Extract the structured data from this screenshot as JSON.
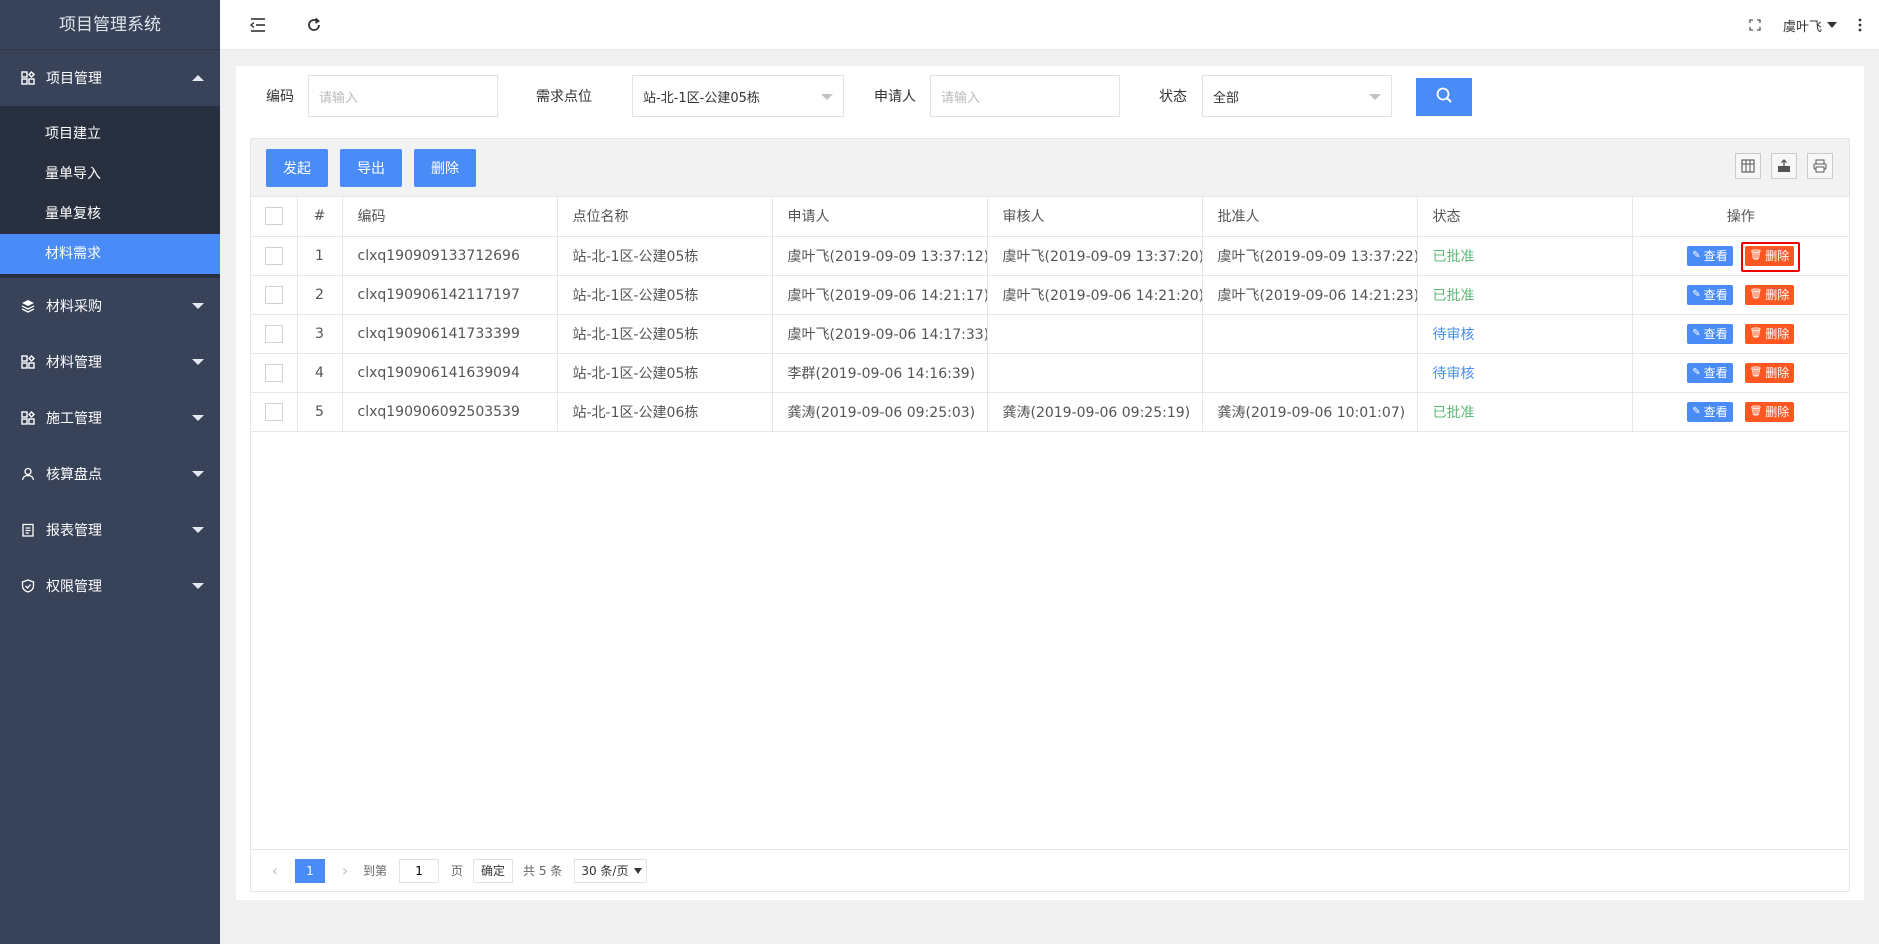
{
  "app": {
    "title": "项目管理系统"
  },
  "header": {
    "user_name": "虞叶飞"
  },
  "sidebar": {
    "groups": [
      {
        "label": "项目管理",
        "icon": "modules-icon",
        "expanded": true,
        "items": [
          {
            "label": "项目建立"
          },
          {
            "label": "量单导入"
          },
          {
            "label": "量单复核"
          },
          {
            "label": "材料需求",
            "active": true
          }
        ]
      },
      {
        "label": "材料采购",
        "icon": "layers-icon"
      },
      {
        "label": "材料管理",
        "icon": "modules-icon"
      },
      {
        "label": "施工管理",
        "icon": "modules-icon"
      },
      {
        "label": "核算盘点",
        "icon": "user-icon"
      },
      {
        "label": "报表管理",
        "icon": "report-icon"
      },
      {
        "label": "权限管理",
        "icon": "shield-icon"
      }
    ]
  },
  "filters": {
    "code_label": "编码",
    "code_placeholder": "请输入",
    "site_label": "需求点位",
    "site_value": "站-北-1区-公建05栋",
    "applicant_label": "申请人",
    "applicant_placeholder": "请输入",
    "status_label": "状态",
    "status_value": "全部"
  },
  "toolbar": {
    "create_label": "发起",
    "export_label": "导出",
    "delete_label": "删除"
  },
  "table": {
    "columns": [
      "#",
      "编码",
      "点位名称",
      "申请人",
      "审核人",
      "批准人",
      "状态",
      "操作"
    ],
    "rows": [
      {
        "no": "1",
        "code": "clxq190909133712696",
        "site": "站-北-1区-公建05栋",
        "applicant": "虞叶飞(2019-09-09 13:37:12)",
        "reviewer": "虞叶飞(2019-09-09 13:37:20)",
        "approver": "虞叶飞(2019-09-09 13:37:22)",
        "status": "已批准",
        "status_type": "approved"
      },
      {
        "no": "2",
        "code": "clxq190906142117197",
        "site": "站-北-1区-公建05栋",
        "applicant": "虞叶飞(2019-09-06 14:21:17)",
        "reviewer": "虞叶飞(2019-09-06 14:21:20)",
        "approver": "虞叶飞(2019-09-06 14:21:23)",
        "status": "已批准",
        "status_type": "approved"
      },
      {
        "no": "3",
        "code": "clxq190906141733399",
        "site": "站-北-1区-公建05栋",
        "applicant": "虞叶飞(2019-09-06 14:17:33)",
        "reviewer": "",
        "approver": "",
        "status": "待审核",
        "status_type": "pending"
      },
      {
        "no": "4",
        "code": "clxq190906141639094",
        "site": "站-北-1区-公建05栋",
        "applicant": "李群(2019-09-06 14:16:39)",
        "reviewer": "",
        "approver": "",
        "status": "待审核",
        "status_type": "pending"
      },
      {
        "no": "5",
        "code": "clxq190906092503539",
        "site": "站-北-1区-公建06栋",
        "applicant": "龚涛(2019-09-06 09:25:03)",
        "reviewer": "龚涛(2019-09-06 09:25:19)",
        "approver": "龚涛(2019-09-06 10:01:07)",
        "status": "已批准",
        "status_type": "approved"
      }
    ],
    "view_label": "查看",
    "delete_label": "删除"
  },
  "pager": {
    "current_page": "1",
    "goto_label": "到第",
    "goto_value": "1",
    "page_unit": "页",
    "confirm_label": "确定",
    "total_text": "共 5 条",
    "page_size": "30 条/页"
  },
  "colors": {
    "sidebar_bg": "#384259",
    "submenu_bg": "#28303f",
    "primary": "#4a8cf7",
    "danger": "#ff5722",
    "approved": "#5fb878",
    "highlight": "#e00000"
  }
}
